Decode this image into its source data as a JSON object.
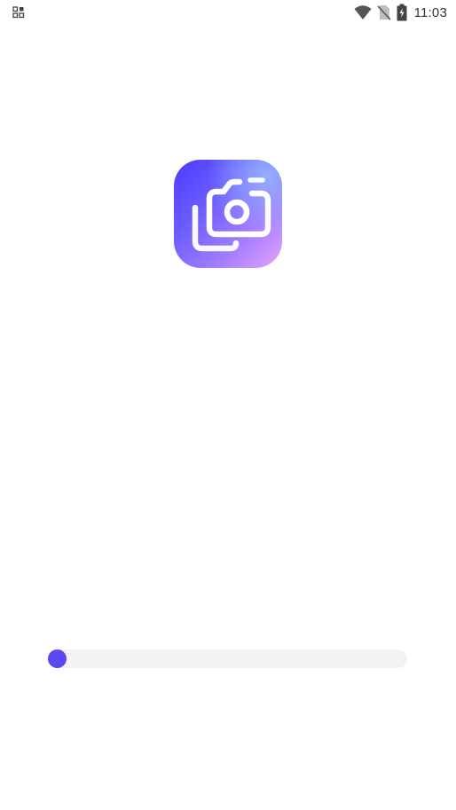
{
  "status_bar": {
    "time": "11:03",
    "icons": [
      "notification-grid-icon",
      "wifi-icon",
      "no-sim-icon",
      "battery-charging-icon"
    ]
  },
  "app": {
    "logo_icon": "gallery-camera-icon",
    "logo_colors": [
      "#4b3bff",
      "#a57eff",
      "#e6a4ff"
    ]
  },
  "loading": {
    "progress": 0.0,
    "track_color": "#f3f3f5",
    "fill_color": "#5a48f0"
  }
}
